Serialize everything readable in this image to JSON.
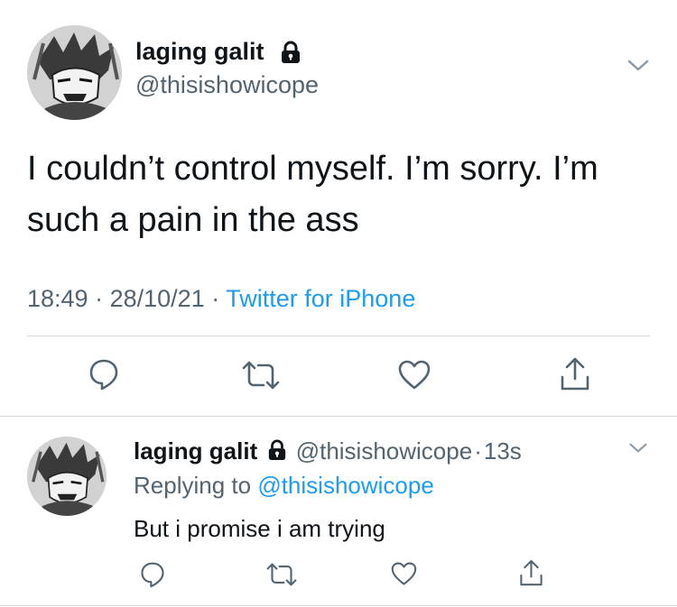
{
  "main_tweet": {
    "display_name": "laging galit",
    "handle": "@thisishowicope",
    "text_line1": "I couldn’t control myself. I’m sorry. I’m",
    "text_line2": "such a pain in the ass",
    "time": "18:49",
    "sep1": "·",
    "date": "28/10/21",
    "sep2": "·",
    "source": "Twitter for iPhone"
  },
  "reply_tweet": {
    "display_name": "laging galit",
    "handle": "@thisishowicope",
    "sep": "·",
    "age": "13s",
    "replying_prefix": "Replying to",
    "replying_handle": "@thisishowicope",
    "text": "But i promise i am trying"
  },
  "icons": {
    "lock": "lock-icon",
    "chevron": "chevron-down-icon",
    "reply": "reply-icon",
    "retweet": "retweet-icon",
    "like": "heart-icon",
    "share": "share-icon"
  },
  "colors": {
    "text": "#0f1419",
    "muted": "#536471",
    "link": "#1d9bf0",
    "divider": "#cfd9de"
  }
}
